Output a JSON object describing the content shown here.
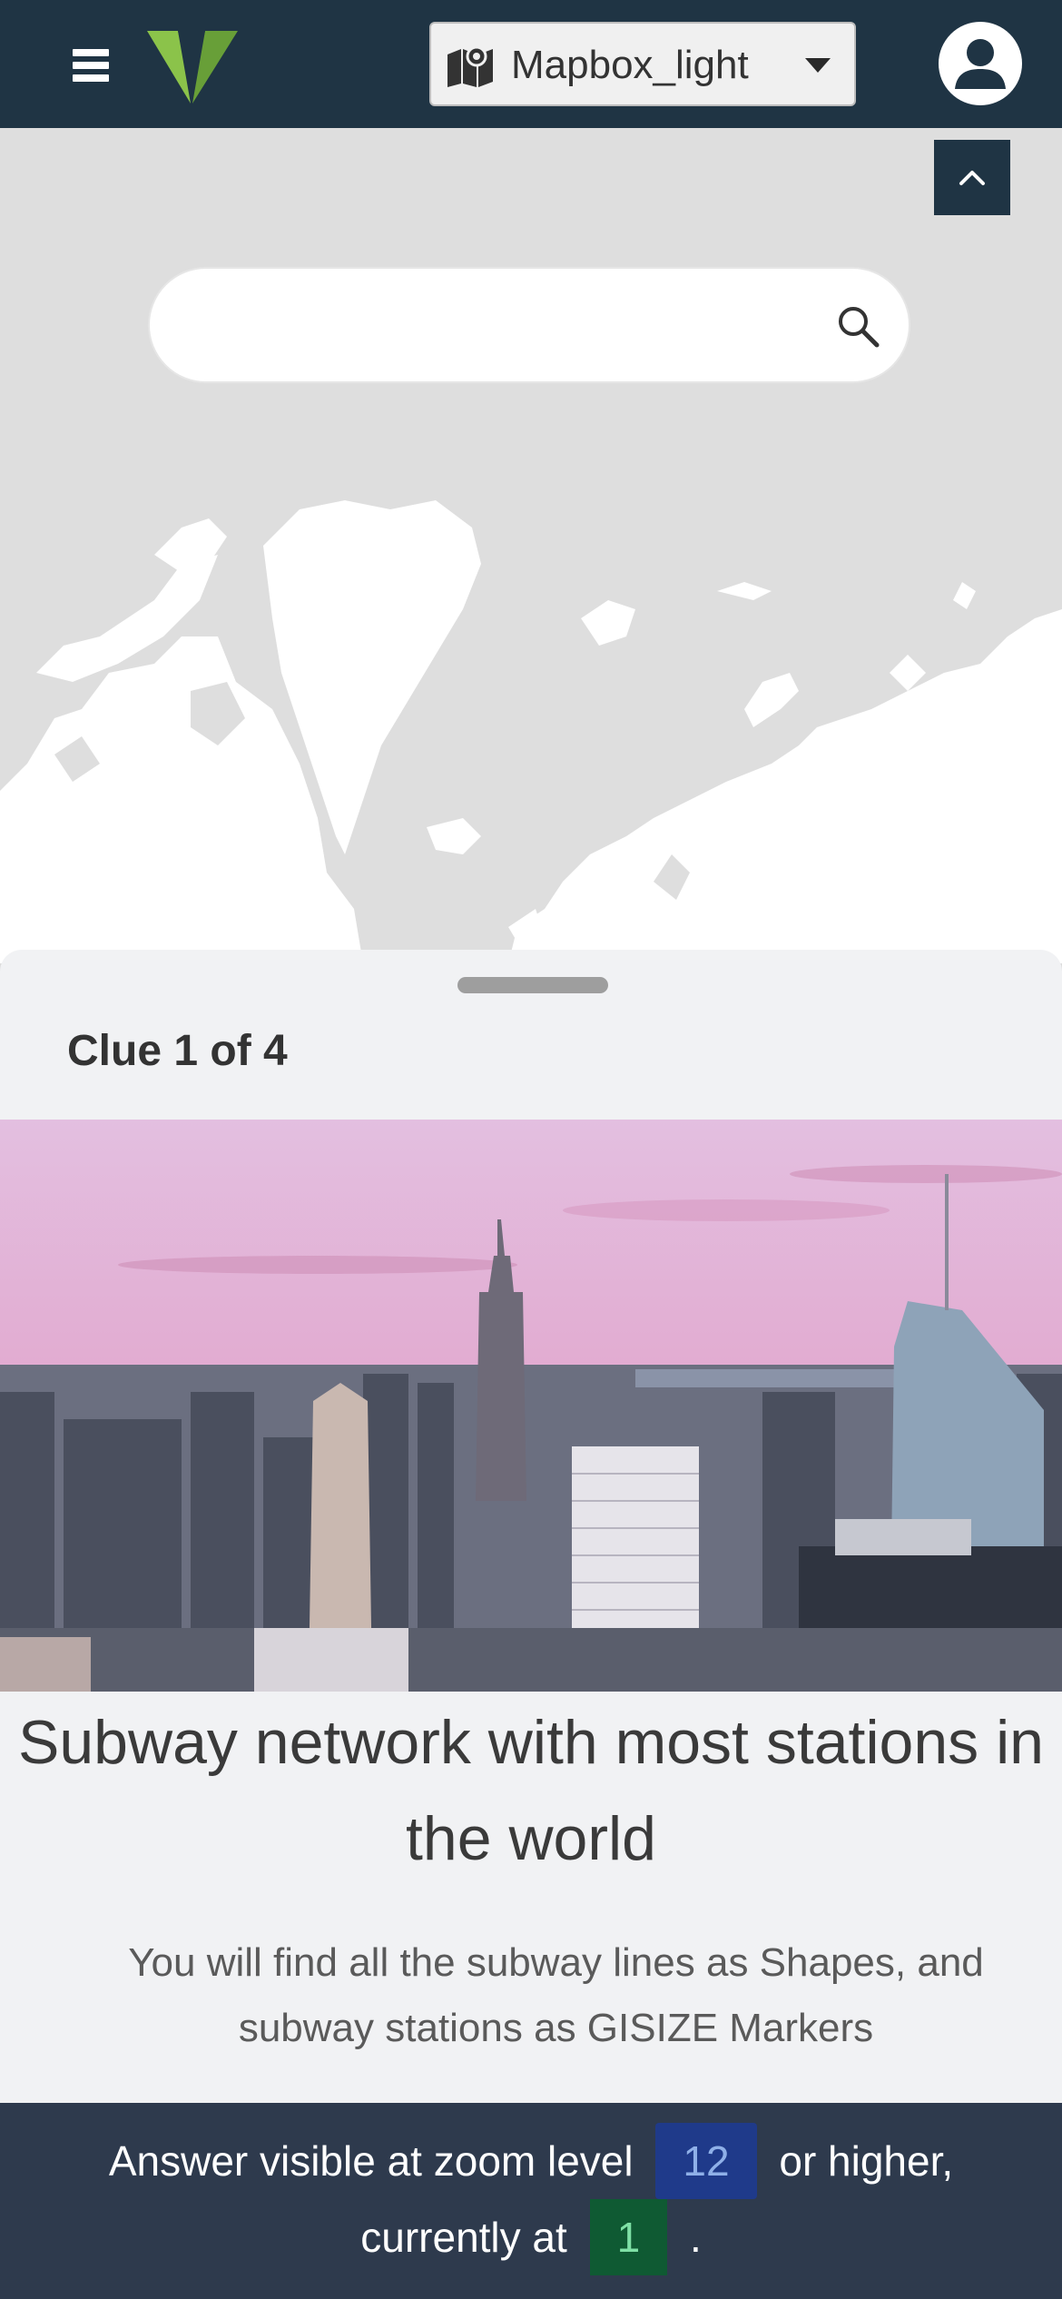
{
  "topbar": {
    "menu_icon": "hamburger-icon",
    "logo_icon": "gisize-v-logo",
    "basemap": {
      "icon": "map-icon",
      "selected": "Mapbox_light",
      "caret_icon": "caret-down-icon"
    },
    "account_icon": "user-avatar-icon"
  },
  "map": {
    "collapse_icon": "chevron-up-icon",
    "search": {
      "value": "",
      "placeholder": "",
      "icon": "search-icon"
    }
  },
  "clue": {
    "title": "Clue 1 of 4",
    "heading": "Subway network with most stations in the world",
    "description": "You will find all the subway lines as Shapes, and subway stations as GISIZE Markers"
  },
  "footer": {
    "text_before_zoom": "Answer visible at zoom level",
    "required_zoom": "12",
    "text_after_zoom": "or higher,",
    "text_before_current": "currently at",
    "current_zoom": "1",
    "text_end": "."
  },
  "colors": {
    "topbar": "#1f3444",
    "footer": "#2e3a4d",
    "required_zoom_badge": "#1f3a8a",
    "current_zoom_badge": "#0f5a33",
    "logo": "#8bc34a"
  }
}
